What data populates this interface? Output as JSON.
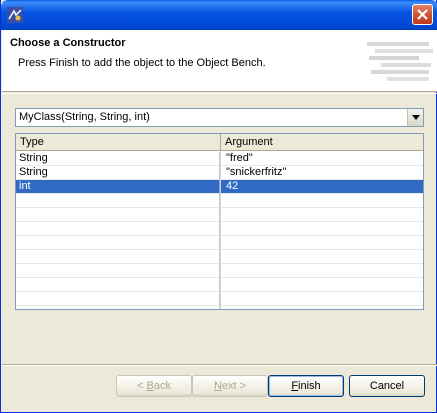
{
  "window": {
    "close_icon": "close-icon"
  },
  "header": {
    "title": "Choose a Constructor",
    "message": "Press Finish to add the object to the Object Bench."
  },
  "constructor_select": {
    "selected": "MyClass(String, String, int)"
  },
  "table": {
    "columns": [
      "Type",
      "Argument"
    ],
    "rows": [
      {
        "type": "String",
        "argument": "\"fred\"",
        "selected": false
      },
      {
        "type": "String",
        "argument": "\"snickerfritz\"",
        "selected": false
      },
      {
        "type": "int",
        "argument": "42",
        "selected": true
      }
    ],
    "empty_row_count": 9
  },
  "buttons": {
    "back": {
      "prefix": "< ",
      "mnemonic": "B",
      "rest": "ack"
    },
    "next": {
      "prefix": "",
      "mnemonic": "N",
      "rest": "ext >"
    },
    "finish": {
      "prefix": "",
      "mnemonic": "F",
      "rest": "inish"
    },
    "cancel": {
      "label": "Cancel"
    }
  },
  "colors": {
    "title_bar": "#0054e3",
    "selection": "#316ac5",
    "dialog_bg": "#ece9d8"
  }
}
